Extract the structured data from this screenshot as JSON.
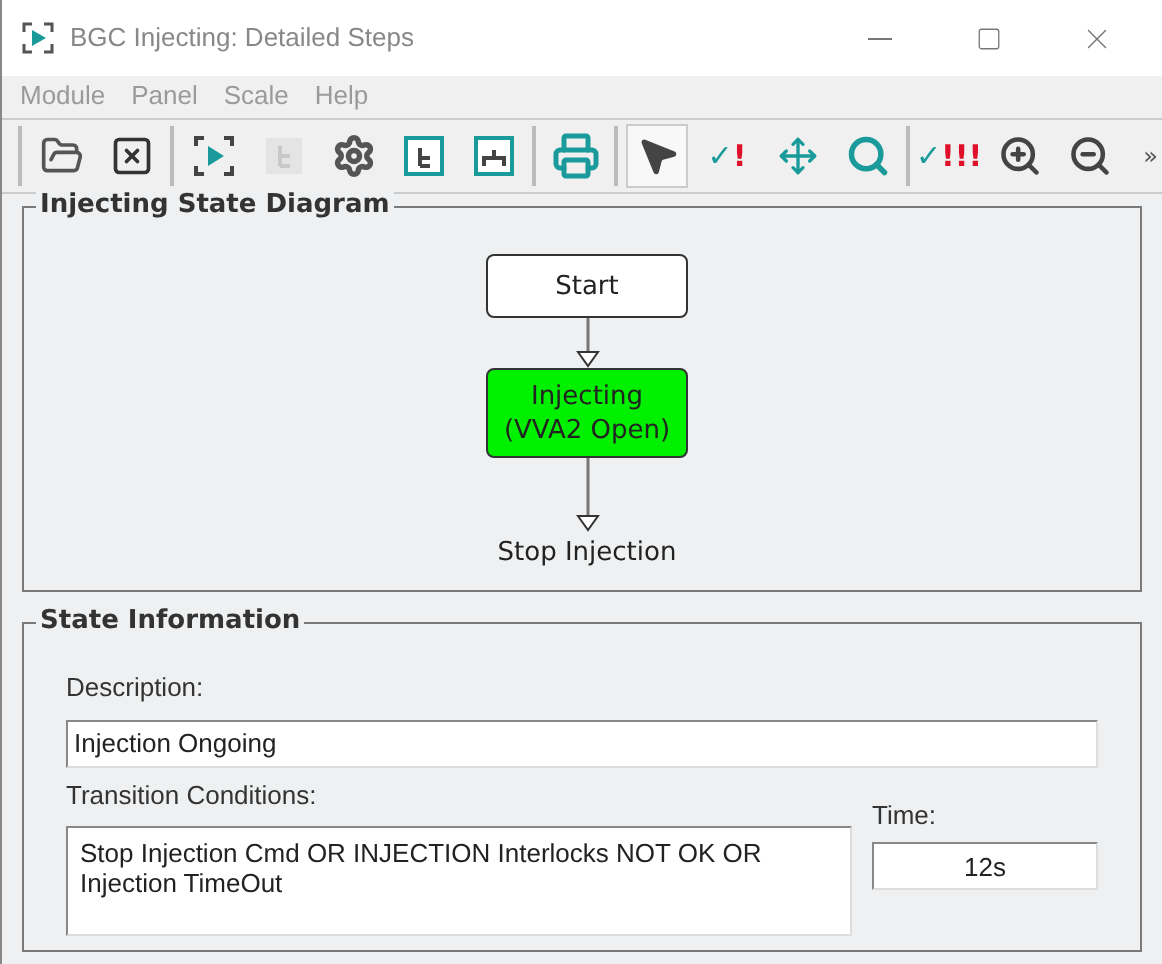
{
  "window": {
    "title": "BGC Injecting: Detailed Steps"
  },
  "menu": [
    {
      "label": "Module",
      "disabled": true
    },
    {
      "label": "Panel",
      "disabled": true
    },
    {
      "label": "Scale",
      "disabled": true
    },
    {
      "label": "Help",
      "disabled": true
    }
  ],
  "toolbar": {
    "groups": [
      [
        {
          "kind": "open",
          "selected": false,
          "disabled": false
        },
        {
          "kind": "close",
          "selected": false,
          "disabled": false
        }
      ],
      [
        {
          "kind": "run",
          "selected": false,
          "disabled": false
        },
        {
          "kind": "tree",
          "selected": false,
          "disabled": true
        },
        {
          "kind": "settings",
          "selected": false,
          "disabled": false
        },
        {
          "kind": "treewindow",
          "selected": false,
          "disabled": false
        },
        {
          "kind": "orgwindow",
          "selected": false,
          "disabled": false
        }
      ],
      [
        {
          "kind": "print",
          "selected": false,
          "disabled": false
        }
      ],
      [
        {
          "kind": "pointer",
          "selected": true,
          "disabled": false
        },
        {
          "kind": "check",
          "label": "✓!",
          "selected": false,
          "disabled": false
        },
        {
          "kind": "move",
          "selected": false,
          "disabled": false
        },
        {
          "kind": "search",
          "selected": false,
          "disabled": false
        }
      ],
      [
        {
          "kind": "check",
          "label": "✓!!!",
          "selected": false,
          "disabled": false
        },
        {
          "kind": "zoomin",
          "selected": false,
          "disabled": false
        },
        {
          "kind": "zoomout",
          "selected": false,
          "disabled": false
        }
      ]
    ],
    "overflow": "»"
  },
  "diagram": {
    "title": "Injecting State Diagram",
    "nodes": [
      {
        "kind": "box",
        "label": "Start",
        "active": false
      },
      {
        "kind": "box",
        "label": "Injecting\n(VVA2 Open)",
        "active": true
      },
      {
        "kind": "end",
        "label": "Stop Injection",
        "active": false
      }
    ]
  },
  "state_information": {
    "title": "State Information",
    "description": {
      "label": "Description:",
      "value": "Injection Ongoing"
    },
    "transition_conditions": {
      "label": "Transition Conditions:",
      "value": "Stop Injection Cmd OR INJECTION Interlocks NOT OK OR Injection TimeOut"
    },
    "time": {
      "label": "Time:",
      "value": "12s"
    }
  }
}
